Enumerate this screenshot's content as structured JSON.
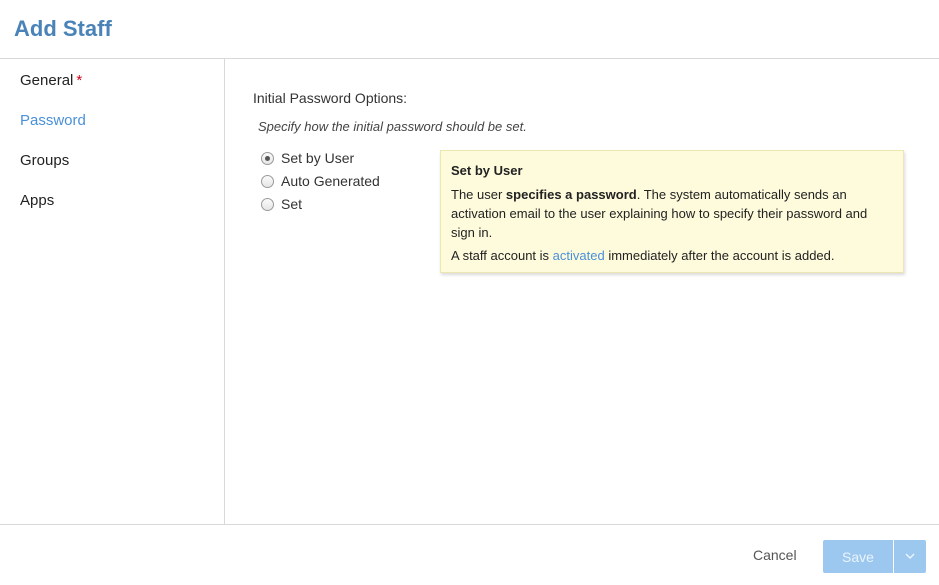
{
  "dialog": {
    "title": "Add Staff"
  },
  "sidebar": {
    "items": [
      {
        "label": "General",
        "required_mark": "*"
      },
      {
        "label": "Password"
      },
      {
        "label": "Groups"
      },
      {
        "label": "Apps"
      }
    ],
    "active_index": 1
  },
  "password": {
    "section_label": "Initial Password Options:",
    "hint": "Specify how the initial password should be set.",
    "options": [
      {
        "label": "Set by User",
        "checked": true
      },
      {
        "label": "Auto Generated",
        "checked": false
      },
      {
        "label": "Set",
        "checked": false
      }
    ],
    "info": {
      "title": "Set by User",
      "p1_prefix": "The user ",
      "p1_bold": "specifies a password",
      "p1_suffix": ". The system automatically sends an activation email to the user explaining how to specify their password and sign in.",
      "p2_prefix": "A staff account is ",
      "p2_link": "activated",
      "p2_suffix": " immediately after the account is added."
    }
  },
  "footer": {
    "cancel_label": "Cancel",
    "save_label": "Save",
    "dropdown_icon": "chevron-down-icon"
  },
  "colors": {
    "accent": "#4a90d9",
    "title": "#4a83b8",
    "required": "#d0021b",
    "save_button_disabled": "#9cc8ef",
    "info_box_bg": "#fefbdc"
  }
}
